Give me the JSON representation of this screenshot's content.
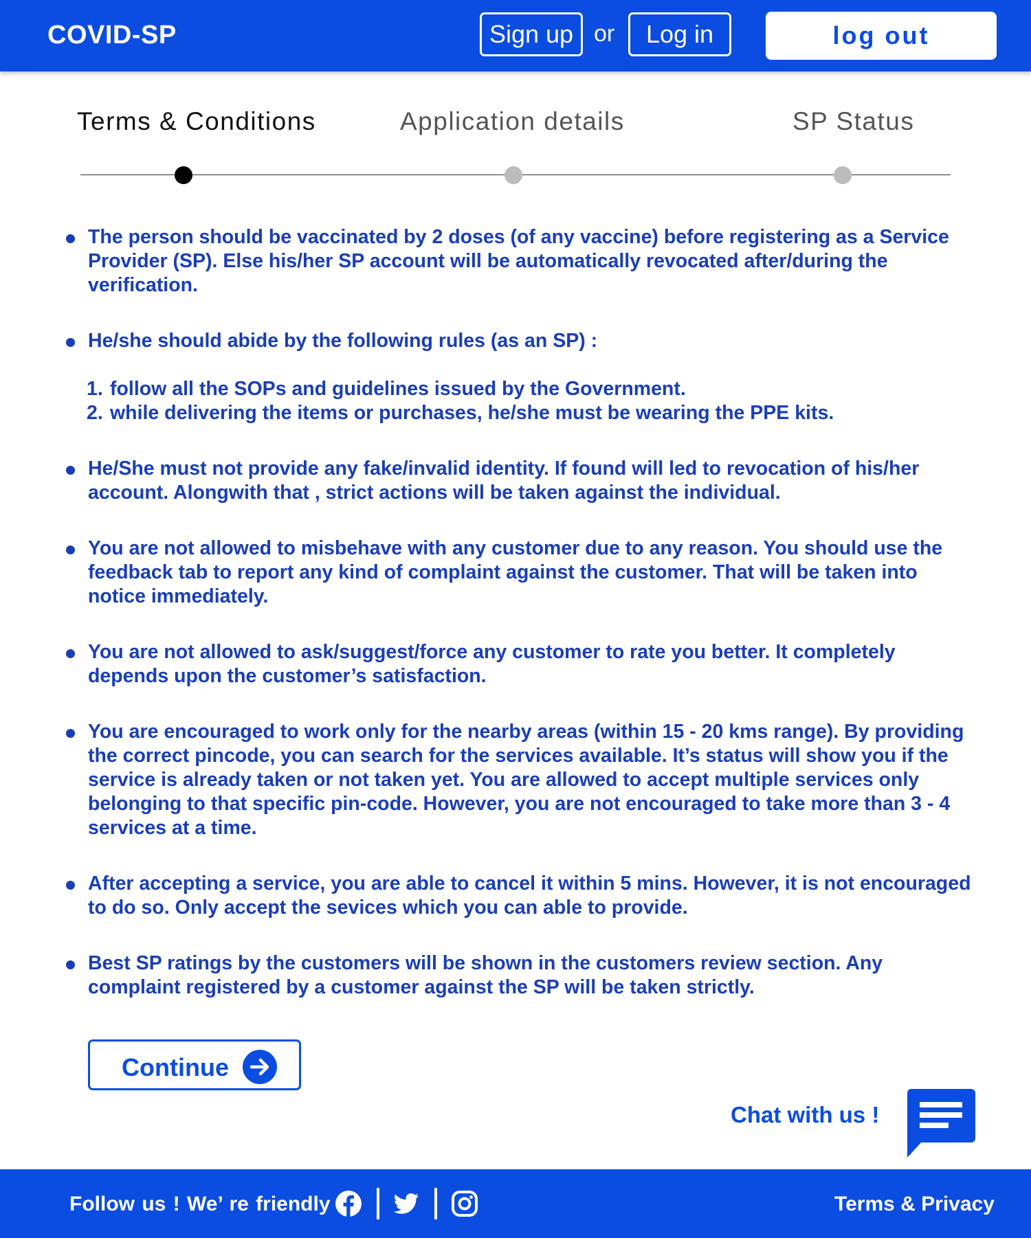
{
  "header": {
    "brand": "COVID-SP",
    "signup_label": "Sign up",
    "or_text": "or",
    "login_label": "Log in",
    "logout_label": "log out"
  },
  "stepper": {
    "steps": [
      {
        "label": "Terms & Conditions",
        "state": "current"
      },
      {
        "label": "Application details",
        "state": "upcoming"
      },
      {
        "label": "SP Status",
        "state": "upcoming"
      }
    ]
  },
  "terms": {
    "items": [
      "The person should be vaccinated by 2 doses (of any vaccine) before registering as a Service Provider (SP). Else his/her SP account will be automatically revocated after/during the verification.",
      "He/she should abide by the following rules (as an SP) :",
      "He/She must not provide any fake/invalid identity. If found will led to revocation of his/her account. Alongwith that , strict actions will be taken against the individual.",
      "You are not allowed to misbehave with any customer due to any reason. You should use the feedback tab to report any kind of complaint against the customer. That will be taken into notice immediately.",
      "You are not allowed to ask/suggest/force any customer to rate you better. It completely depends upon the customer’s satisfaction.",
      "You are encouraged to work only for the nearby areas (within 15 - 20 kms range). By providing the correct pincode, you can search for the services available. It’s status will show you if the service is already taken or not taken yet. You are allowed to accept multiple services only belonging to that specific pin-code. However, you are not encouraged to take more than 3 - 4 services at a time.",
      "After accepting a service, you are able to cancel it within 5 mins. However, it is not encouraged to do so. Only accept the sevices which you can able to provide.",
      "Best SP ratings by the customers will be shown in the customers review section. Any complaint registered by a customer against the SP will be taken strictly."
    ],
    "rules": [
      {
        "num": "1.",
        "text": "follow all the SOPs and guidelines issued by the Government."
      },
      {
        "num": "2.",
        "text": "while delivering the items or purchases, he/she must be wearing the PPE kits."
      }
    ]
  },
  "continue_label": "Continue",
  "chat_label": "Chat with us !",
  "footer": {
    "follow_text": "Follow us !  We’ re friendly :",
    "terms_privacy": "Terms & Privacy",
    "social_icons": [
      "facebook-icon",
      "twitter-icon",
      "instagram-icon"
    ]
  },
  "colors": {
    "primary": "#0b4de0",
    "text_blue": "#1a3eb6",
    "inactive_dot": "#bcbcbc"
  }
}
